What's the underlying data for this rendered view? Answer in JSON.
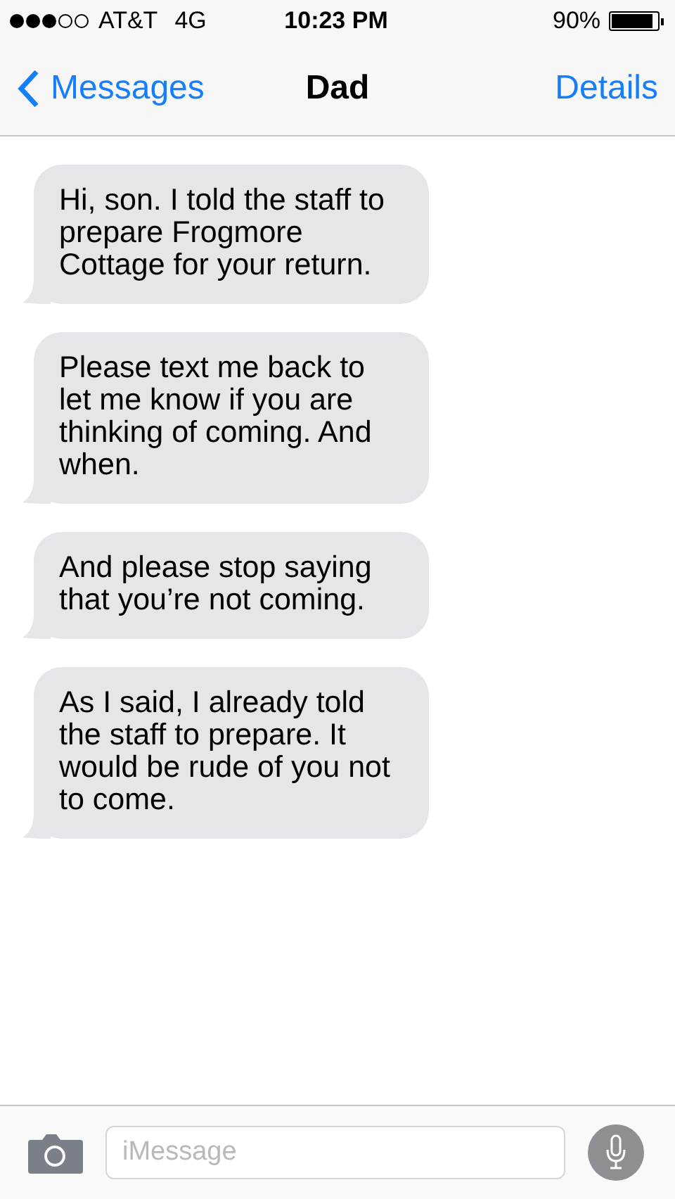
{
  "status_bar": {
    "carrier": "AT&T",
    "network": "4G",
    "time": "10:23 PM",
    "battery_text": "90%"
  },
  "nav": {
    "back_label": "Messages",
    "title": "Dad",
    "action": "Details"
  },
  "messages": [
    {
      "kind": "incoming",
      "text": "Hi, son. I told the staff to prepare Frogmore Cottage for your return."
    },
    {
      "kind": "incoming",
      "text": "Please text me back to let me know if you are thinking of coming. And when."
    },
    {
      "kind": "incoming",
      "text": "And please stop saying that you’re not coming."
    },
    {
      "kind": "incoming",
      "text": "As I said, I already told the staff to prepare. It would be rude of you not to come."
    }
  ],
  "composer": {
    "placeholder": "iMessage"
  }
}
